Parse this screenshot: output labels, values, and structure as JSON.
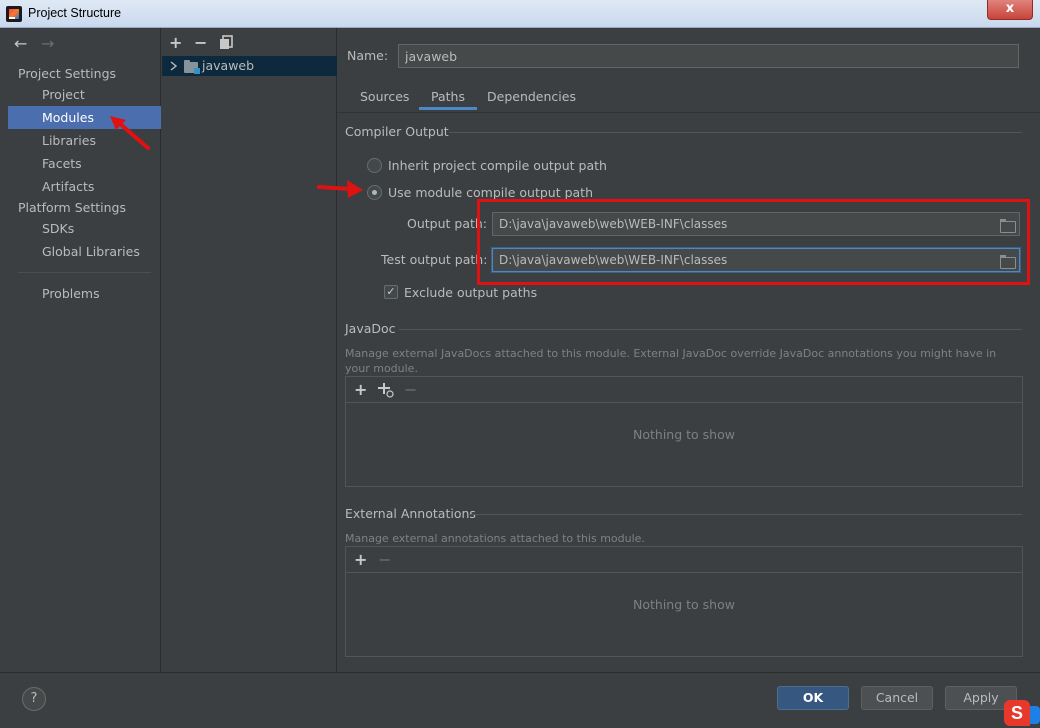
{
  "window": {
    "title": "Project Structure",
    "close_glyph": "x"
  },
  "nav": {
    "back_glyph": "←",
    "forward_glyph": "→",
    "project_settings_header": "Project Settings",
    "project_settings_items": [
      "Project",
      "Modules",
      "Libraries",
      "Facets",
      "Artifacts"
    ],
    "platform_settings_header": "Platform Settings",
    "platform_settings_items": [
      "SDKs",
      "Global Libraries"
    ],
    "problems_label": "Problems",
    "selected_item": "Modules"
  },
  "tree": {
    "add_glyph": "+",
    "remove_glyph": "−",
    "module_name": "javaweb"
  },
  "content": {
    "name_label": "Name:",
    "name_value": "javaweb",
    "tabs": [
      "Sources",
      "Paths",
      "Dependencies"
    ],
    "active_tab": "Paths",
    "compiler_output": {
      "title": "Compiler Output",
      "inherit_label": "Inherit project compile output path",
      "use_module_label": "Use module compile output path",
      "output_path_label": "Output path:",
      "output_path_value": "D:\\java\\javaweb\\web\\WEB-INF\\classes",
      "test_output_path_label": "Test output path:",
      "test_output_path_value": "D:\\java\\javaweb\\web\\WEB-INF\\classes",
      "exclude_label": "Exclude output paths",
      "exclude_checked": true,
      "selected_option": "use_module"
    },
    "javadoc": {
      "title": "JavaDoc",
      "description": "Manage external JavaDocs attached to this module. External JavaDoc override JavaDoc annotations you might have in your module.",
      "empty_text": "Nothing to show"
    },
    "external_annotations": {
      "title": "External Annotations",
      "description": "Manage external annotations attached to this module.",
      "empty_text": "Nothing to show"
    }
  },
  "buttons": {
    "help": "?",
    "ok": "OK",
    "cancel": "Cancel",
    "apply": "Apply"
  },
  "tray": {
    "ime_letter": "S"
  },
  "colors": {
    "background": "#3c3f41",
    "selection": "#4b6eaf",
    "annotation_red": "#e01111",
    "primary_button": "#365880"
  }
}
